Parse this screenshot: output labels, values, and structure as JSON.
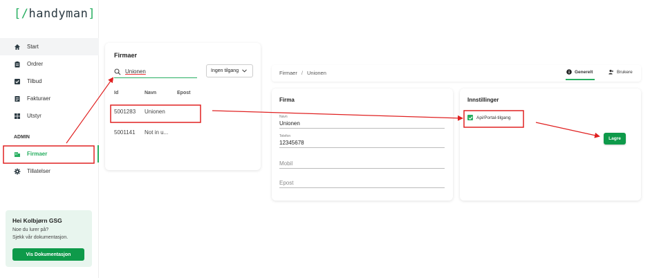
{
  "logo": {
    "open": "[/",
    "name": "handyman",
    "close": "]"
  },
  "sidebar": {
    "items": [
      {
        "label": "Start"
      },
      {
        "label": "Ordrer"
      },
      {
        "label": "Tilbud"
      },
      {
        "label": "Fakturaer"
      },
      {
        "label": "Utstyr"
      }
    ],
    "admin_label": "ADMIN",
    "admin_items": [
      {
        "label": "Firmaer"
      },
      {
        "label": "Tillatelser"
      }
    ]
  },
  "help": {
    "heading": "Hei Kolbjørn GSG",
    "line1": "Noe du lurer på?",
    "line2": "Sjekk vår dokumentasjon.",
    "button": "Vis Dokumentasjon"
  },
  "firmaer": {
    "title": "Firmaer",
    "search_value": "Unionen",
    "filter": "Ingen tilgang",
    "columns": [
      "Id",
      "Navn",
      "Epost"
    ],
    "rows": [
      {
        "id": "5001283",
        "name": "Unionen",
        "email": ""
      },
      {
        "id": "5001141",
        "name": "Not in u...",
        "email": ""
      }
    ]
  },
  "breadcrumb": {
    "root": "Firmaer",
    "sep": "/",
    "current": "Unionen"
  },
  "tabs": {
    "general": "Generelt",
    "users": "Brukere"
  },
  "form": {
    "title": "Firma",
    "name_label": "Navn",
    "name_value": "Unionen",
    "phone_label": "Telefon",
    "phone_value": "12345678",
    "mobile_placeholder": "Mobil",
    "email_placeholder": "Epost"
  },
  "settings": {
    "title": "Innstillinger",
    "checkbox_label": "Api/Portal-tilgang",
    "save": "Lagre"
  },
  "colors": {
    "accent": "#27ae60",
    "button": "#0e9a4a",
    "annotation": "#e02020"
  }
}
